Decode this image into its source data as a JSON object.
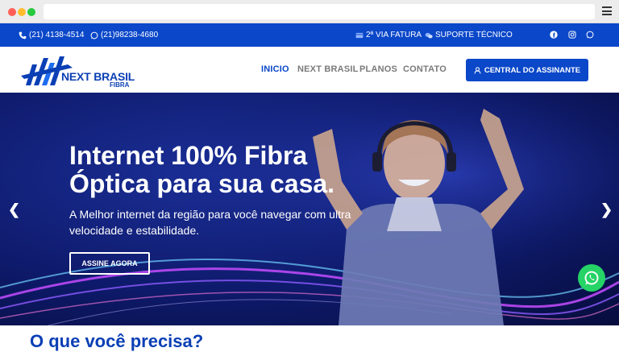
{
  "topbar": {
    "phone": "(21) 4138-4514",
    "whatsapp": "(21)98238-4680",
    "invoice": "2ª VIA FATURA",
    "support": "SUPORTE TÉCNICO"
  },
  "logo": {
    "name": "NEXT BRASIL",
    "sub": "FIBRA"
  },
  "nav": [
    {
      "label": "INICIO",
      "active": true
    },
    {
      "label": "NEXT BRASIL"
    },
    {
      "label": "PLANOS"
    },
    {
      "label": "CONTATO"
    }
  ],
  "cta": {
    "label": "CENTRAL DO ASSINANTE"
  },
  "hero": {
    "title": "Internet 100% Fibra Óptica para sua casa.",
    "subtitle": "A Melhor internet da região para você navegar com ultra velocidade e estabilidade.",
    "button": "ASSINE AGORA"
  },
  "section": {
    "title": "O que você precisa?"
  },
  "colors": {
    "brand": "#0a47c9",
    "whatsapp": "#25d366"
  },
  "icons": [
    "phone-icon",
    "whatsapp-icon",
    "invoice-icon",
    "support-icon",
    "facebook-icon",
    "instagram-icon",
    "user-icon"
  ]
}
